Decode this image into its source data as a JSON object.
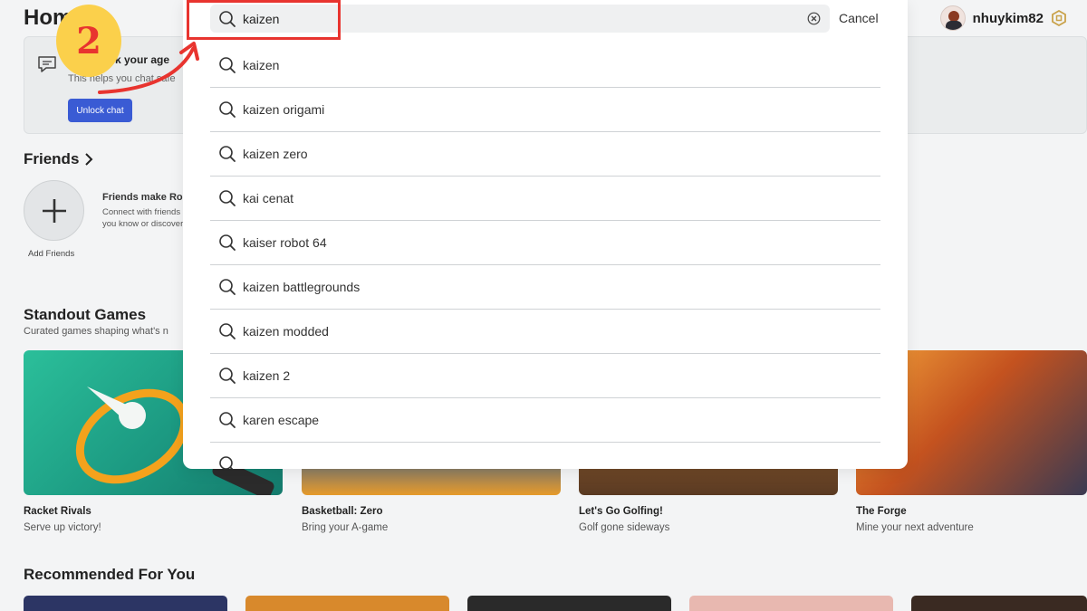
{
  "page": {
    "title": "Hom"
  },
  "user": {
    "name": "nhuykim82"
  },
  "age_card": {
    "title": "k your age",
    "subtitle": "This helps you chat safe",
    "unlock_label": "Unlock chat"
  },
  "friends": {
    "title": "Friends",
    "add_label": "Add Friends",
    "info_title": "Friends make Ro",
    "info_sub": "Connect with friends you know or discover n"
  },
  "standout": {
    "title": "Standout Games",
    "subtitle": "Curated games shaping what's n",
    "games": [
      {
        "name": "Racket Rivals",
        "desc": "Serve up victory!"
      },
      {
        "name": "Basketball: Zero",
        "desc": "Bring your A-game"
      },
      {
        "name": "Let's Go Golfing!",
        "desc": "Golf gone sideways"
      },
      {
        "name": "The Forge",
        "desc": "Mine your next adventure"
      }
    ]
  },
  "recommended": {
    "title": "Recommended For You"
  },
  "search": {
    "query": "kaizen",
    "cancel_label": "Cancel",
    "suggestions": [
      "kaizen",
      "kaizen origami",
      "kaizen zero",
      "kai cenat",
      "kaiser robot 64",
      "kaizen battlegrounds",
      "kaizen modded",
      "kaizen 2",
      "karen escape"
    ]
  },
  "annotation": {
    "step_number": "2"
  },
  "colors": {
    "accent_red": "#e8342f",
    "badge_yellow": "#fbd04b",
    "unlock_blue": "#3a5bd4"
  }
}
